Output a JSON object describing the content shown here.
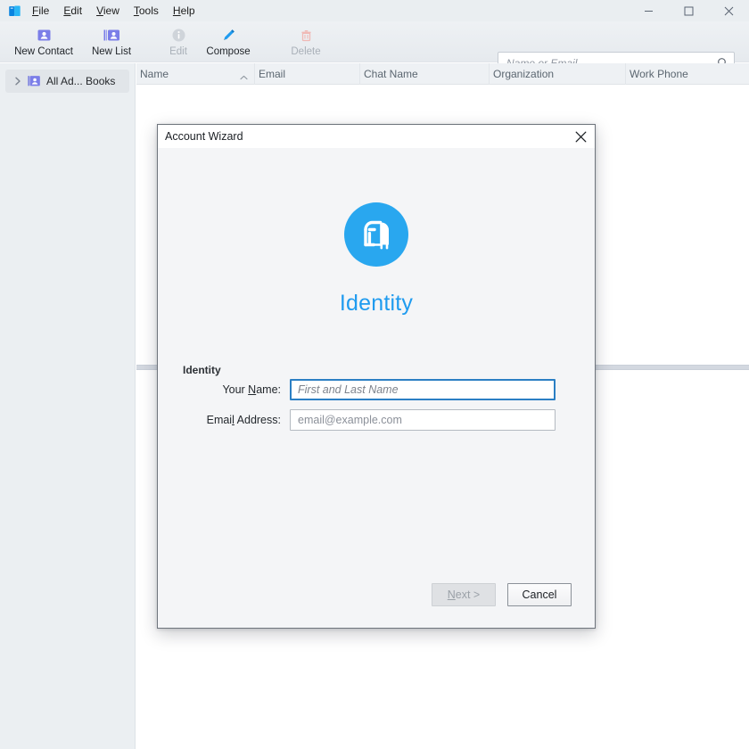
{
  "window": {
    "app_icon": "address-book-icon",
    "controls": {
      "minimize": "minimize-icon",
      "maximize": "maximize-icon",
      "close": "close-icon"
    }
  },
  "menubar": {
    "items": [
      {
        "label": "File",
        "pre": "",
        "acc": "F",
        "post": "ile"
      },
      {
        "label": "Edit",
        "pre": "",
        "acc": "E",
        "post": "dit"
      },
      {
        "label": "View",
        "pre": "",
        "acc": "V",
        "post": "iew"
      },
      {
        "label": "Tools",
        "pre": "",
        "acc": "T",
        "post": "ools"
      },
      {
        "label": "Help",
        "pre": "",
        "acc": "H",
        "post": "elp"
      }
    ]
  },
  "toolbar": {
    "buttons": [
      {
        "label": "New Contact",
        "icon": "new-contact-icon",
        "enabled": true
      },
      {
        "label": "New List",
        "icon": "new-list-icon",
        "enabled": true
      },
      {
        "label": "Edit",
        "icon": "info-icon",
        "enabled": false
      },
      {
        "label": "Compose",
        "icon": "pencil-icon",
        "enabled": true
      },
      {
        "label": "Delete",
        "icon": "trash-icon",
        "enabled": false
      }
    ],
    "search": {
      "value": "",
      "placeholder": "Name or Email",
      "icon": "search-icon"
    }
  },
  "sidebar": {
    "items": [
      {
        "label": "All Ad... Books",
        "icon": "address-book-icon",
        "twisty": "chevron-right-icon",
        "selected": true
      }
    ]
  },
  "list": {
    "columns": [
      {
        "label": "Name",
        "sorted": "ascending"
      },
      {
        "label": "Email",
        "sorted": ""
      },
      {
        "label": "Chat Name",
        "sorted": ""
      },
      {
        "label": "Organization",
        "sorted": ""
      },
      {
        "label": "Work Phone",
        "sorted": ""
      }
    ],
    "rows": []
  },
  "dialog": {
    "title": "Account Wizard",
    "close_icon": "close-icon",
    "logo_icon": "mailbox-icon",
    "heading": "Identity",
    "section_label": "Identity",
    "fields": [
      {
        "label_pre": "Your ",
        "label_acc": "N",
        "label_post": "ame:",
        "value": "",
        "placeholder": "First and Last Name",
        "focused": true
      },
      {
        "label_pre": "Emai",
        "label_acc": "l",
        "label_post": " Address:",
        "value": "",
        "placeholder": "email@example.com",
        "focused": false
      }
    ],
    "buttons": [
      {
        "label_pre": "",
        "label_acc": "N",
        "label_post": "ext >",
        "enabled": false
      },
      {
        "label_pre": "",
        "label_acc": "",
        "label_post": "Cancel",
        "enabled": true
      }
    ]
  },
  "colors": {
    "accent": "#1f9bef",
    "focus_border": "#2b7fc4",
    "chrome": "#eaeef1",
    "sidebar": "#ebeff2"
  }
}
